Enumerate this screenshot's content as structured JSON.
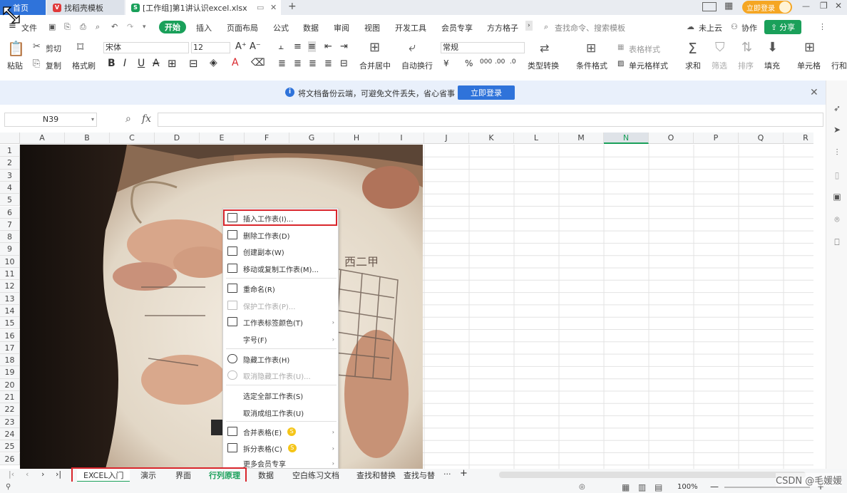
{
  "titlebar": {
    "tabs": [
      {
        "label": "首页"
      },
      {
        "label": "找稻壳模板"
      },
      {
        "label": "[工作组]第1讲认识excel.xlsx"
      }
    ],
    "login_label": "立即登录"
  },
  "menubar": {
    "file": "文件",
    "items": [
      "开始",
      "插入",
      "页面布局",
      "公式",
      "数据",
      "审阅",
      "视图",
      "开发工具",
      "会员专享",
      "方方格子"
    ],
    "search_placeholder": "查找命令、搜索模板",
    "cloud": "未上云",
    "collab": "协作",
    "share": "分享"
  },
  "ribbon": {
    "paste": "粘贴",
    "cut": "剪切",
    "copy": "复制",
    "format_painter": "格式刷",
    "font_name": "宋体",
    "font_size": "12",
    "merge_center": "合并居中",
    "wrap_text": "自动换行",
    "number_format": "常规",
    "type_convert": "类型转换",
    "conditional_format": "条件格式",
    "table_style": "表格样式",
    "cell_style": "单元格样式",
    "sum": "求和",
    "filter": "筛选",
    "sort": "排序",
    "fill": "填充",
    "cell": "单元格",
    "row_col": "行和"
  },
  "banner": {
    "message": "将文档备份云端，可避免文件丢失，省心省事",
    "button": "立即登录"
  },
  "formula_bar": {
    "cell_ref": "N39",
    "value": ""
  },
  "grid": {
    "columns": [
      "A",
      "B",
      "C",
      "D",
      "E",
      "F",
      "G",
      "H",
      "I",
      "J",
      "K",
      "L",
      "M",
      "N",
      "O",
      "P",
      "Q",
      "R"
    ],
    "rows": [
      "1",
      "2",
      "3",
      "4",
      "5",
      "6",
      "7",
      "8",
      "9",
      "10",
      "11",
      "12",
      "13",
      "14",
      "15",
      "16",
      "17",
      "18",
      "19",
      "20",
      "21",
      "22",
      "23",
      "24",
      "25",
      "26"
    ],
    "selected_column": "N"
  },
  "context_menu": {
    "items": [
      {
        "label": "插入工作表(I)...",
        "enabled": true
      },
      {
        "label": "删除工作表(D)",
        "enabled": true
      },
      {
        "label": "创建副本(W)",
        "enabled": true
      },
      {
        "label": "移动或复制工作表(M)...",
        "enabled": true
      },
      {
        "label": "重命名(R)",
        "enabled": true
      },
      {
        "label": "保护工作表(P)...",
        "enabled": false
      },
      {
        "label": "工作表标签颜色(T)",
        "enabled": true
      },
      {
        "label": "字号(F)",
        "enabled": true
      },
      {
        "label": "隐藏工作表(H)",
        "enabled": true
      },
      {
        "label": "取消隐藏工作表(U)...",
        "enabled": false
      },
      {
        "label": "选定全部工作表(S)",
        "enabled": true
      },
      {
        "label": "取消成组工作表(U)",
        "enabled": true
      },
      {
        "label": "合并表格(E)",
        "enabled": true
      },
      {
        "label": "拆分表格(C)",
        "enabled": true
      },
      {
        "label": "更多会员专享",
        "enabled": true
      }
    ]
  },
  "sheets": {
    "tabs": [
      "EXCEL入门",
      "演示",
      "界面",
      "行列原理",
      "数据",
      "空白练习文档",
      "查找和替换",
      "查找与替"
    ],
    "active": "EXCEL入门",
    "more": "···",
    "add": "+"
  },
  "status": {
    "zoom": "100%",
    "watermark": "CSDN @毛媛媛"
  },
  "colors": {
    "accent_blue": "#2f73da",
    "accent_green": "#1aa05a",
    "highlight_red": "#d9262c",
    "login_orange": "#f5a623"
  }
}
